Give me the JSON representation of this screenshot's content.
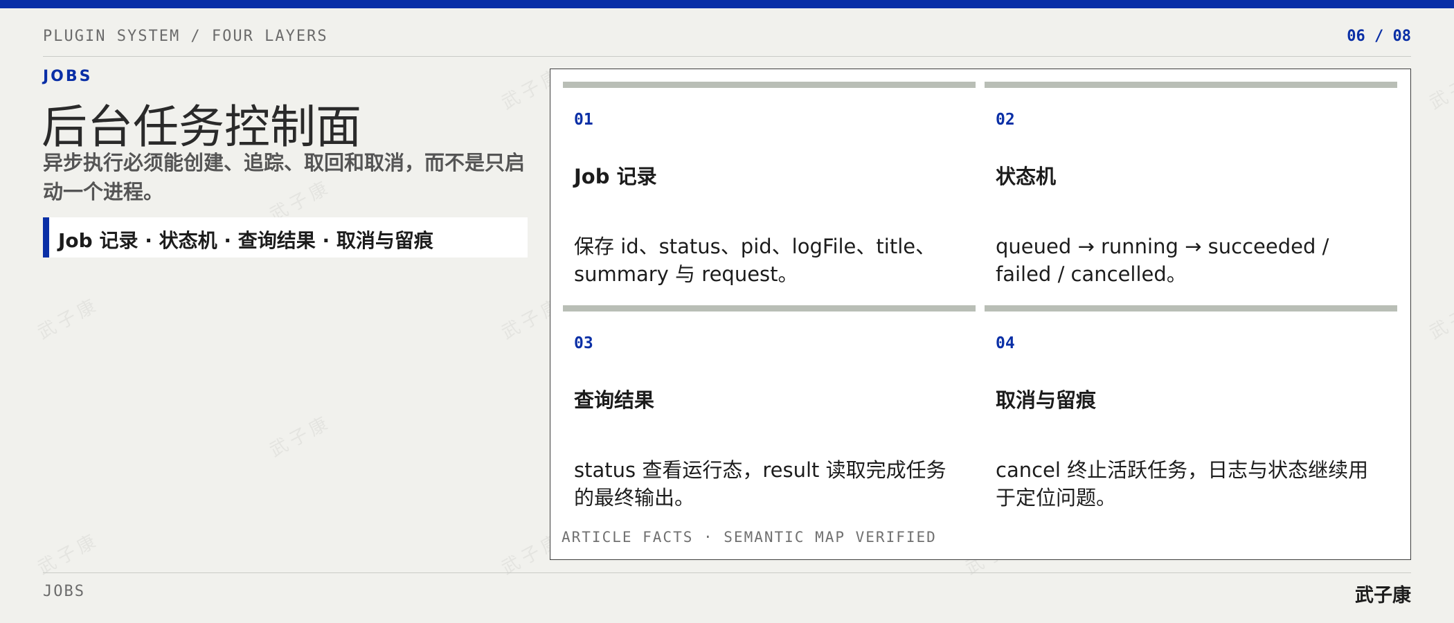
{
  "header": {
    "section_path": "PLUGIN SYSTEM / FOUR LAYERS",
    "page_counter": "06 / 08"
  },
  "intro": {
    "kicker": "JOBS",
    "title": "后台任务控制面",
    "subtitle": "异步执行必须能创建、追踪、取回和取消，而不是只启动一个进程。",
    "summary": "Job 记录 · 状态机 · 查询结果 · 取消与留痕"
  },
  "cards": [
    {
      "number": "01",
      "title": "Job 记录",
      "body": "保存 id、status、pid、logFile、title、summary 与 request。"
    },
    {
      "number": "02",
      "title": "状态机",
      "body": "queued → running → succeeded / failed / cancelled。"
    },
    {
      "number": "03",
      "title": "查询结果",
      "body": "status 查看运行态，result 读取完成任务的最终输出。"
    },
    {
      "number": "04",
      "title": "取消与留痕",
      "body": "cancel 终止活跃任务，日志与状态继续用于定位问题。"
    }
  ],
  "panel_footer": "ARTICLE FACTS · SEMANTIC MAP VERIFIED",
  "footer": {
    "section": "JOBS",
    "author": "武子康"
  },
  "watermark": "武子康",
  "colors": {
    "accent": "#0a2fa6",
    "background": "#f1f1ed",
    "card_rule": "#b9beb6",
    "panel": "#ffffff"
  }
}
